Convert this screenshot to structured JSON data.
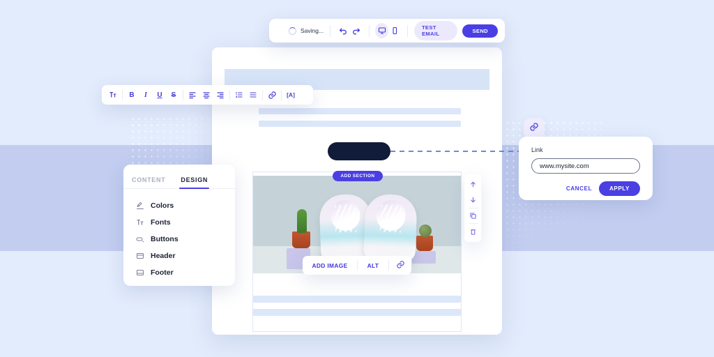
{
  "toolbar": {
    "saving_label": "Saving...",
    "spinner_icon": "spinner-icon",
    "undo_icon": "undo-icon",
    "redo_icon": "redo-icon",
    "desktop_icon": "desktop-preview-icon",
    "mobile_icon": "mobile-preview-icon",
    "test_email_label": "TEST EMAIL",
    "send_label": "SEND",
    "accent_color": "#4a3fe3",
    "test_bg_color": "#ece9fd"
  },
  "format_toolbar": {
    "items": [
      {
        "name": "font-size-icon",
        "glyph": "ᴛ"
      },
      {
        "name": "bold-icon",
        "glyph": "B"
      },
      {
        "name": "italic-icon",
        "glyph": "I"
      },
      {
        "name": "underline-icon",
        "glyph": "U"
      },
      {
        "name": "strikethrough-icon",
        "glyph": "S"
      },
      {
        "name": "align-left-icon",
        "glyph": ""
      },
      {
        "name": "align-center-icon",
        "glyph": ""
      },
      {
        "name": "align-right-icon",
        "glyph": ""
      },
      {
        "name": "ordered-list-icon",
        "glyph": ""
      },
      {
        "name": "bulleted-list-icon",
        "glyph": ""
      },
      {
        "name": "insert-link-icon",
        "glyph": ""
      },
      {
        "name": "merge-tag-icon",
        "glyph": "[A]"
      }
    ]
  },
  "design_panel": {
    "tabs": [
      {
        "label": "CONTENT",
        "active": false
      },
      {
        "label": "DESIGN",
        "active": true
      }
    ],
    "items": [
      {
        "label": "Colors",
        "icon": "color-dropper-icon"
      },
      {
        "label": "Fonts",
        "icon": "font-size-icon"
      },
      {
        "label": "Buttons",
        "icon": "button-icon"
      },
      {
        "label": "Header",
        "icon": "header-layout-icon"
      },
      {
        "label": "Footer",
        "icon": "footer-layout-icon"
      }
    ]
  },
  "canvas": {
    "add_section_label": "ADD SECTION",
    "image_tools": {
      "add_image_label": "ADD IMAGE",
      "alt_label": "ALT",
      "link_icon": "link-icon"
    },
    "block_tools": [
      {
        "name": "move-up-icon"
      },
      {
        "name": "move-down-icon"
      },
      {
        "name": "duplicate-icon"
      },
      {
        "name": "delete-icon"
      }
    ]
  },
  "link_popup": {
    "badge_icon": "link-icon",
    "label": "Link",
    "value": "www.mysite.com",
    "cancel_label": "CANCEL",
    "apply_label": "APPLY"
  },
  "theme": {
    "background_top": "#e3ecfc",
    "background_mid": "#c2cdf0",
    "primary": "#4a3fe3",
    "cta_dark": "#111c3a"
  }
}
